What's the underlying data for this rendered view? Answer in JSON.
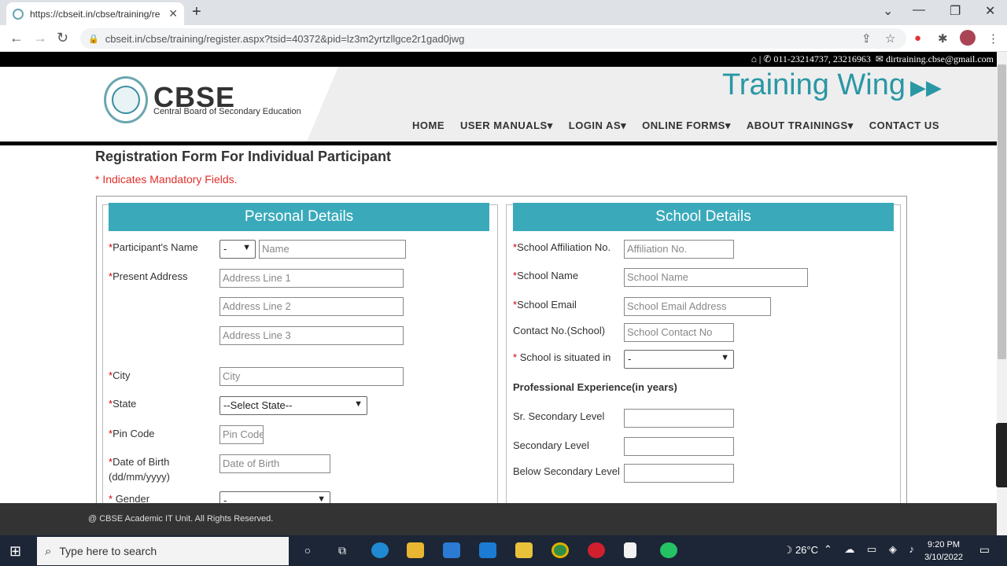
{
  "browser": {
    "tab_title": "https://cbseit.in/cbse/training/re",
    "url": "cbseit.in/cbse/training/register.aspx?tsid=40372&pid=lz3m2yrtzllgce2r1gad0jwg",
    "new_tab": "+",
    "back": "←",
    "forward": "→",
    "reload": "↻",
    "minimize": "—",
    "restore": "❐",
    "close": "✕",
    "chevron": "⌄"
  },
  "topstrip": {
    "home_icon": "⌂",
    "phone": "011-23214737, 23216963",
    "email": "dirtraining.cbse@gmail.com"
  },
  "header": {
    "brand": "CBSE",
    "brand_sub": "Central Board of Secondary Education",
    "training_wing": "Training Wing",
    "nav": [
      "HOME",
      "USER MANUALS",
      "LOGIN AS",
      "ONLINE FORMS",
      "ABOUT TRAININGS",
      "CONTACT US"
    ]
  },
  "form": {
    "title": "Registration Form For Individual Participant",
    "mandatory_note": "* Indicates Mandatory Fields.",
    "personal": {
      "heading": "Personal Details",
      "participant_name_label": "Participant's Name",
      "salutation_value": "-",
      "name_placeholder": "Name",
      "address_label": "Present Address",
      "address1_placeholder": "Address Line 1",
      "address2_placeholder": "Address Line 2",
      "address3_placeholder": "Address Line 3",
      "city_label": "City",
      "city_placeholder": "City",
      "state_label": "State",
      "state_value": "--Select State--",
      "pincode_label": "Pin Code",
      "pincode_placeholder": "Pin Code",
      "dob_label": "Date of Birth",
      "dob_format": "(dd/mm/yyyy)",
      "dob_placeholder": "Date of Birth",
      "gender_label": "Gender",
      "gender_value": "-"
    },
    "school": {
      "heading": "School Details",
      "affiliation_label": "School Affiliation No.",
      "affiliation_placeholder": "Affiliation No.",
      "school_name_label": "School Name",
      "school_name_placeholder": "School Name",
      "school_email_label": "School Email",
      "school_email_placeholder": "School Email Address",
      "contact_label": "Contact No.(School)",
      "contact_placeholder": "School Contact No",
      "situated_label": "School is situated in",
      "situated_value": "-",
      "prof_exp_heading": "Professional Experience(in years)",
      "sr_secondary_label": "Sr. Secondary Level",
      "secondary_label": "Secondary Level",
      "below_secondary_label": "Below Secondary Level"
    }
  },
  "footer": {
    "text": "@ CBSE Academic IT Unit. All Rights Reserved."
  },
  "taskbar": {
    "search_placeholder": "Type here to search",
    "temperature": "26°C",
    "time": "9:20 PM",
    "date": "3/10/2022"
  }
}
